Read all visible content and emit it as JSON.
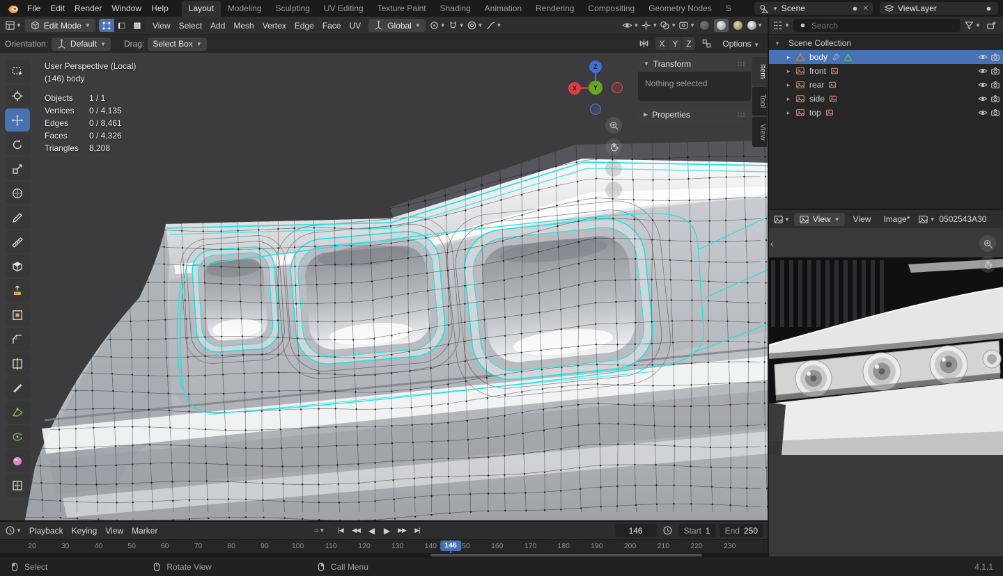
{
  "topbar": {
    "logo_icon": "blender-logo-icon",
    "menus": [
      "File",
      "Edit",
      "Render",
      "Window",
      "Help"
    ],
    "tabs": [
      "Layout",
      "Modeling",
      "Sculpting",
      "UV Editing",
      "Texture Paint",
      "Shading",
      "Animation",
      "Rendering",
      "Compositing",
      "Geometry Nodes",
      "S"
    ],
    "active_tab": "Layout",
    "scene": {
      "icon": "scene-icon",
      "label": "Scene",
      "close_icon": "x-icon"
    },
    "view_layer": {
      "icon": "viewlayer-icon",
      "label": "ViewLayer",
      "copy_icon": "copy-icon"
    }
  },
  "viewport_header": {
    "editor_icon": "editor-3d-viewport-icon",
    "mode": "Edit Mode",
    "select_modes": [
      "vertex-select-icon",
      "edge-select-icon",
      "face-select-icon"
    ],
    "active_select_mode": "vertex-select-icon",
    "menus": [
      "View",
      "Select",
      "Add",
      "Mesh",
      "Vertex",
      "Edge",
      "Face",
      "UV"
    ],
    "orientation": "Global",
    "left_icons": [
      "pivot-point-icon",
      "snap-magnet-icon",
      "proportional-editing-icon",
      "falloff-curve-icon"
    ],
    "right_icons": [
      "visibility-icon",
      "gizmo-icon",
      "overlays-icon",
      "xray-icon"
    ],
    "shading_modes": [
      "shading-wireframe-icon",
      "shading-solid-icon",
      "shading-material-icon",
      "shading-rendered-icon"
    ],
    "active_shading": "shading-solid-icon"
  },
  "tool_settings": {
    "orientation_label": "Orientation:",
    "orientation_value": "Default",
    "drag_label": "Drag:",
    "drag_value": "Select Box",
    "mirror_icon": "mirror-icon",
    "mirror_axes": [
      "X",
      "Y",
      "Z"
    ],
    "snap_icon": "snap-to-icon",
    "options_label": "Options"
  },
  "toolbar": {
    "active_tool": "Move",
    "tools": [
      "Select Box",
      "Cursor",
      "Move",
      "Rotate",
      "Scale",
      "Transform",
      "Annotate",
      "Measure",
      "Add Cube",
      "Extrude Region",
      "Inset Faces",
      "Bevel",
      "Loop Cut",
      "Knife",
      "Poly Build",
      "Spin",
      "Smooth",
      "Edge Slide"
    ]
  },
  "viewport": {
    "overlay_title": "User Perspective (Local)",
    "overlay_subtitle": "(146) body",
    "stats": [
      {
        "label": "Objects",
        "value": "1 / 1"
      },
      {
        "label": "Vertices",
        "value": "0 / 4,135"
      },
      {
        "label": "Edges",
        "value": "0 / 8,461"
      },
      {
        "label": "Faces",
        "value": "0 / 4,326"
      },
      {
        "label": "Triangles",
        "value": "8,208"
      }
    ],
    "gizmo": {
      "axes": [
        "Z",
        "Y",
        "X"
      ]
    },
    "nav_icons": [
      "zoom-icon",
      "pan-hand-icon",
      "camera-view-icon",
      "grid-ortho-icon"
    ]
  },
  "sidebar": {
    "tabs": [
      "Item",
      "Tool",
      "View"
    ],
    "active_tab": "Item",
    "transform_title": "Transform",
    "empty_text": "Nothing selected",
    "properties_title": "Properties"
  },
  "outliner": {
    "search_placeholder": "Search",
    "root_label": "Scene Collection",
    "items": [
      {
        "label": "body",
        "selected": true
      },
      {
        "label": "front",
        "selected": false
      },
      {
        "label": "rear",
        "selected": false
      },
      {
        "label": "side",
        "selected": false
      },
      {
        "label": "top",
        "selected": false
      }
    ]
  },
  "image_editor": {
    "editor_icon": "image-editor-icon",
    "mode_dropdown": "View",
    "menus": [
      "View",
      "Image*"
    ],
    "datablock_icon": "image-datablock-icon",
    "image_name": "0502543A30"
  },
  "timeline": {
    "editor_icon": "timeline-editor-icon",
    "menus": [
      "Playback",
      "Keying",
      "View",
      "Marker"
    ],
    "record_icon": "auto-keying-icon",
    "playback_icons": [
      "jump-start-icon",
      "prev-keyframe-icon",
      "play-reverse-icon",
      "play-icon",
      "next-keyframe-icon",
      "jump-end-icon"
    ],
    "current_frame": "146",
    "start_label": "Start",
    "start_value": "1",
    "end_label": "End",
    "end_value": "250",
    "ticks": [
      20,
      30,
      40,
      50,
      60,
      70,
      80,
      90,
      100,
      110,
      120,
      130,
      140,
      150,
      160,
      170,
      180,
      190,
      200,
      210,
      220,
      230
    ]
  },
  "statusbar": {
    "hints": [
      {
        "icon": "mouse-left-icon",
        "label": "Select"
      },
      {
        "icon": "mouse-middle-icon",
        "label": "Rotate View"
      },
      {
        "icon": "mouse-right-icon",
        "label": "Call Menu"
      }
    ],
    "version": "4.1.1"
  },
  "colors": {
    "accent": "#4772b3",
    "selected_edge": "#1ee3e3",
    "mesh_orange": "#e8842c"
  }
}
